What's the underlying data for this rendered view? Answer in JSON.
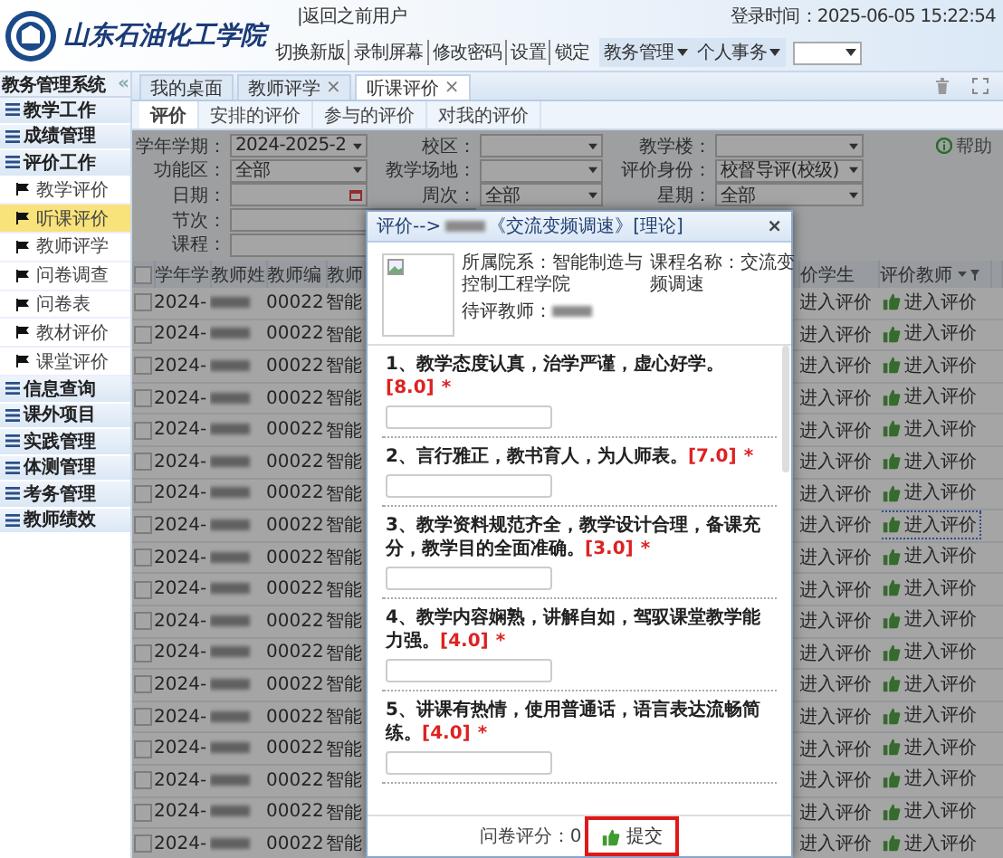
{
  "header": {
    "school_name": "山东石油化工学院",
    "return_link": "|返回之前用户",
    "links": [
      "切换新版",
      "录制屏幕",
      "修改密码",
      "设置",
      "锁定"
    ],
    "menus": [
      {
        "label": "教务管理"
      },
      {
        "label": "个人事务"
      }
    ],
    "login_time": "登录时间：2025-06-05 15:22:54"
  },
  "sidebar": {
    "title": "教务管理系统",
    "collapse": "«",
    "groups": [
      {
        "label": "教学工作"
      },
      {
        "label": "成绩管理"
      },
      {
        "label": "评价工作",
        "children": [
          {
            "label": "教学评价",
            "selected": false
          },
          {
            "label": "听课评价",
            "selected": true
          },
          {
            "label": "教师评学",
            "selected": false
          },
          {
            "label": "问卷调查",
            "selected": false
          },
          {
            "label": "问卷表",
            "selected": false
          },
          {
            "label": "教材评价",
            "selected": false
          },
          {
            "label": "课堂评价",
            "selected": false
          }
        ]
      },
      {
        "label": "信息查询"
      },
      {
        "label": "课外项目"
      },
      {
        "label": "实践管理"
      },
      {
        "label": "体测管理"
      },
      {
        "label": "考务管理"
      },
      {
        "label": "教师绩效"
      }
    ]
  },
  "tabs": [
    {
      "label": "我的桌面",
      "selected": false
    },
    {
      "label": "教师评学",
      "close": "×",
      "selected": false
    },
    {
      "label": "听课评价",
      "close": "×",
      "selected": true
    }
  ],
  "subtabs": [
    {
      "label": "评价",
      "selected": true
    },
    {
      "label": "安排的评价",
      "selected": false
    },
    {
      "label": "参与的评价",
      "selected": false
    },
    {
      "label": "对我的评价",
      "selected": false
    }
  ],
  "filters": [
    {
      "label": "学年学期：",
      "value": "2024-2025-2",
      "kind": "select"
    },
    {
      "label": "校区：",
      "kind": "select"
    },
    {
      "label": "教学楼：",
      "kind": "select"
    },
    {
      "label": "功能区：",
      "value": "全部",
      "kind": "select"
    },
    {
      "label": "教学场地：",
      "kind": "select"
    },
    {
      "label": "评价身份：",
      "value": "校督导评(校级)",
      "kind": "select"
    },
    {
      "label": "日期：",
      "kind": "date"
    },
    {
      "label": "周次：",
      "value": "全部",
      "kind": "select"
    },
    {
      "label": "星期：",
      "value": "全部",
      "kind": "select"
    },
    {
      "label": "节次：",
      "kind": "text"
    },
    {
      "label": "课程：",
      "kind": "text"
    }
  ],
  "help": "帮助",
  "table": {
    "select_all_checked": false,
    "columns_left": [
      "学年学",
      "教师姓",
      "教师编",
      "教师"
    ],
    "columns_right": [
      "价学生",
      "评价教师"
    ],
    "rows": [
      {
        "checked": false,
        "year": "2024-",
        "code": "00022",
        "dept": "智能",
        "student_eval": "进入评价",
        "teacher_eval": "进入评价",
        "focused": false
      },
      {
        "checked": false,
        "year": "2024-",
        "code": "00022",
        "dept": "智能",
        "student_eval": "进入评价",
        "teacher_eval": "进入评价",
        "focused": false
      },
      {
        "checked": false,
        "year": "2024-",
        "code": "00022",
        "dept": "智能",
        "student_eval": "进入评价",
        "teacher_eval": "进入评价",
        "focused": false
      },
      {
        "checked": false,
        "year": "2024-",
        "code": "00022",
        "dept": "智能",
        "student_eval": "进入评价",
        "teacher_eval": "进入评价",
        "focused": false
      },
      {
        "checked": false,
        "year": "2024-",
        "code": "00022",
        "dept": "智能",
        "student_eval": "进入评价",
        "teacher_eval": "进入评价",
        "focused": false
      },
      {
        "checked": false,
        "year": "2024-",
        "code": "00022",
        "dept": "智能",
        "student_eval": "进入评价",
        "teacher_eval": "进入评价",
        "focused": false
      },
      {
        "checked": false,
        "year": "2024-",
        "code": "00022",
        "dept": "智能",
        "student_eval": "进入评价",
        "teacher_eval": "进入评价",
        "focused": false
      },
      {
        "checked": false,
        "year": "2024-",
        "code": "00022",
        "dept": "智能",
        "student_eval": "进入评价",
        "teacher_eval": "进入评价",
        "focused": true
      },
      {
        "checked": false,
        "year": "2024-",
        "code": "00022",
        "dept": "智能",
        "student_eval": "进入评价",
        "teacher_eval": "进入评价",
        "focused": false
      },
      {
        "checked": false,
        "year": "2024-",
        "code": "00022",
        "dept": "智能",
        "student_eval": "进入评价",
        "teacher_eval": "进入评价",
        "focused": false
      },
      {
        "checked": false,
        "year": "2024-",
        "code": "00022",
        "dept": "智能",
        "student_eval": "进入评价",
        "teacher_eval": "进入评价",
        "focused": false
      },
      {
        "checked": false,
        "year": "2024-",
        "code": "00022",
        "dept": "智能",
        "student_eval": "进入评价",
        "teacher_eval": "进入评价",
        "focused": false
      },
      {
        "checked": false,
        "year": "2024-",
        "code": "00022",
        "dept": "智能",
        "student_eval": "进入评价",
        "teacher_eval": "进入评价",
        "focused": false
      },
      {
        "checked": false,
        "year": "2024-",
        "code": "00022",
        "dept": "智能",
        "student_eval": "进入评价",
        "teacher_eval": "进入评价",
        "focused": false
      },
      {
        "checked": false,
        "year": "2024-",
        "code": "00022",
        "dept": "智能",
        "student_eval": "进入评价",
        "teacher_eval": "进入评价",
        "focused": false
      },
      {
        "checked": false,
        "year": "2024-",
        "code": "00022",
        "dept": "智能",
        "student_eval": "进入评价",
        "teacher_eval": "进入评价",
        "focused": false
      },
      {
        "checked": false,
        "year": "2024-",
        "code": "00022",
        "dept": "智能",
        "student_eval": "进入评价",
        "teacher_eval": "进入评价",
        "focused": false
      },
      {
        "checked": false,
        "year": "2024-",
        "code": "00022",
        "dept": "智能",
        "student_eval": "进入评价",
        "teacher_eval": "进入评价",
        "focused": false
      }
    ]
  },
  "dialog": {
    "title_prefix": "评价-->",
    "title": "《交流变频调速》[理论]",
    "close": "×",
    "department": "所属院系：智能制造与控制工程学院",
    "course": "课程名称：交流变频调速",
    "teacher_label": "待评教师：",
    "questions": [
      {
        "text": "1、教学态度认真，治学严谨，虚心好学。",
        "score": "[8.0]",
        "mark": "*"
      },
      {
        "text": "2、言行雅正，教书育人，为人师表。",
        "score": "[7.0]",
        "mark": "*"
      },
      {
        "text": "3、教学资料规范齐全，教学设计合理，备课充分，教学目的全面准确。",
        "score": "[3.0]",
        "mark": "*"
      },
      {
        "text": "4、教学内容娴熟，讲解自如，驾驭课堂教学能力强。",
        "score": "[4.0]",
        "mark": "*"
      },
      {
        "text": "5、讲课有热情，使用普通话，语言表达流畅简练。",
        "score": "[4.0]",
        "mark": "*"
      }
    ],
    "score_label": "问卷评分：0",
    "submit": {
      "label": "提交",
      "highlighted": true
    }
  }
}
